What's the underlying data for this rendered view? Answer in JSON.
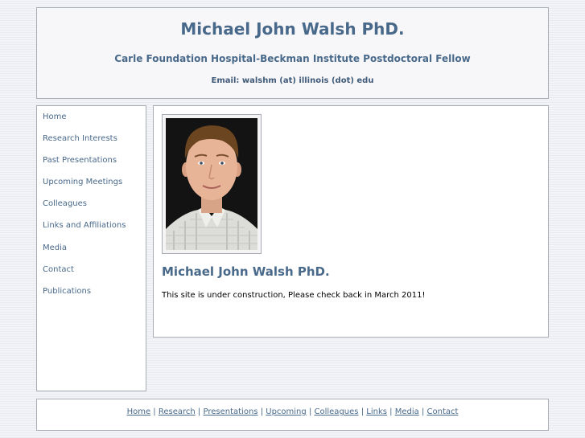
{
  "header": {
    "title": "Michael John Walsh PhD.",
    "subtitle": "Carle Foundation Hospital-Beckman Institute Postdoctoral Fellow",
    "email": "Email: walshm (at) illinois (dot) edu"
  },
  "sidebar": {
    "items": [
      {
        "label": "Home"
      },
      {
        "label": "Research Interests"
      },
      {
        "label": "Past Presentations"
      },
      {
        "label": "Upcoming Meetings"
      },
      {
        "label": "Colleagues"
      },
      {
        "label": "Links and Affiliations"
      },
      {
        "label": "Media"
      },
      {
        "label": "Contact"
      },
      {
        "label": "Publications"
      }
    ]
  },
  "content": {
    "heading": "Michael John Walsh PhD.",
    "text": "This site is under construction, Please check back in March 2011!"
  },
  "footer": {
    "links": [
      {
        "label": "Home"
      },
      {
        "label": "Research"
      },
      {
        "label": "Presentations"
      },
      {
        "label": "Upcoming"
      },
      {
        "label": "Colleagues"
      },
      {
        "label": "Links"
      },
      {
        "label": "Media"
      },
      {
        "label": "Contact"
      }
    ],
    "separator": "|"
  },
  "colors": {
    "accent": "#49698a",
    "border": "#a8acb4",
    "background": "#eef0f5"
  }
}
